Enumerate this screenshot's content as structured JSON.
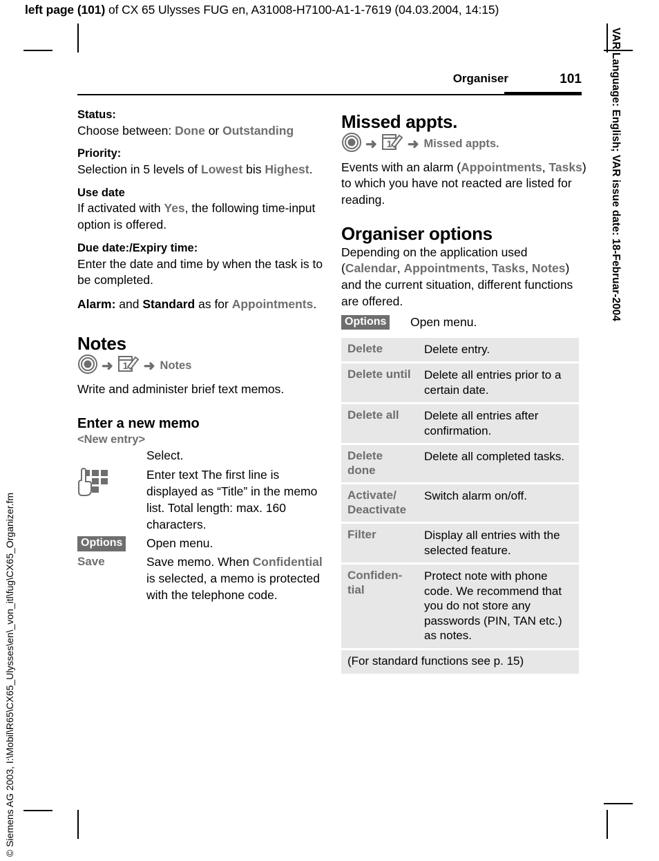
{
  "print_header": {
    "bold_prefix": "left page (101)",
    "rest": " of CX 65 Ulysses FUG en, A31008-H7100-A1-1-7619 (04.03.2004, 14:15)"
  },
  "margin_notes": {
    "right": "VAR Language: English; VAR issue date: 18-Februar-2004",
    "left": "© Siemens AG 2003, I:\\Mobil\\R65\\CX65_Ulysses\\en\\_von_itl\\fug\\CX65_Organizer.fm"
  },
  "page_header": {
    "chapter": "Organiser",
    "folio": "101"
  },
  "left_column": {
    "status": {
      "heading": "Status:",
      "text_prefix": "Choose between: ",
      "gui_1": "Done",
      "mid": " or ",
      "gui_2": "Outstanding"
    },
    "priority": {
      "heading": "Priority:",
      "text_prefix": "Selection in 5 levels of ",
      "gui_1": "Lowest",
      "mid": " bis ",
      "gui_2": "Highest",
      "suffix": "."
    },
    "use_date": {
      "heading": "Use date",
      "text_prefix": "If activated with ",
      "gui_1": "Yes",
      "suffix": ", the following time-input option is offered."
    },
    "due_date": {
      "heading": "Due date:/Expiry time:",
      "text": "Enter the date and time by when the task is to be completed."
    },
    "alarm": {
      "kw_1": "Alarm:",
      "mid_1": " and ",
      "kw_2": "Standard",
      "mid_2": " as for ",
      "gui_1": "Appointments",
      "suffix": "."
    },
    "notes_section": {
      "title": "Notes",
      "nav": {
        "arrow": "➜",
        "menu_number": "1",
        "target": "Notes"
      },
      "intro": "Write and administer brief text memos."
    },
    "new_memo": {
      "title": "Enter a new memo",
      "new_entry_label": "<New entry>",
      "rows": [
        {
          "key_type": "none",
          "key": "",
          "value": "Select."
        },
        {
          "key_type": "keypad-icon",
          "key": "keypad-icon",
          "value": "Enter text The first line is displayed as “Title” in the memo list. Total length: max. 160 characters."
        },
        {
          "key_type": "softkey",
          "key": "Options",
          "value": "Open menu."
        }
      ],
      "save_row": {
        "key": "Save",
        "prefix": "Save memo. When ",
        "gui_1": "Confidential",
        "suffix": " is selected, a memo is protected with the telephone code."
      }
    }
  },
  "right_column": {
    "missed": {
      "title": "Missed appts.",
      "nav": {
        "arrow": "➜",
        "menu_number": "1",
        "target": "Missed appts."
      },
      "text_prefix": "Events with an alarm (",
      "gui_1": "Appointments",
      "comma": ", ",
      "gui_2": "Tasks",
      "suffix": ") to which you have not reacted are listed for reading."
    },
    "organiser_options": {
      "title": "Organiser options",
      "intro_1": "Depending on the application used (",
      "gui_1": "Calendar",
      "sep_1": ", ",
      "gui_2": "Appointments",
      "sep_2": ", ",
      "gui_3": "Tasks",
      "sep_3": ", ",
      "gui_4": "Notes",
      "intro_2": ") and the current situation, different functions are offered.",
      "softkey": "Options",
      "softkey_desc": "Open menu.",
      "table": {
        "rows": [
          {
            "label": "Delete",
            "desc": "Delete entry."
          },
          {
            "label": "Delete until",
            "desc": "Delete all entries prior to a certain date."
          },
          {
            "label": "Delete all",
            "desc": "Delete all entries after confirmation."
          },
          {
            "label": "Delete done",
            "desc": "Delete all completed tasks."
          },
          {
            "label": "Activate/ Deactivate",
            "desc": "Switch alarm on/off."
          },
          {
            "label": "Filter",
            "desc": "Display all entries with the selected feature."
          },
          {
            "label": "Confiden- tial",
            "desc": "Protect note with phone code. We recommend that you do not store any passwords (PIN, TAN etc.) as notes."
          }
        ],
        "footnote": "(For standard functions see  p. 15)"
      }
    }
  },
  "colors": {
    "gui_gray": "#6e6e6e",
    "table_row_bg": "#e7e7e7",
    "softkey_bg": "#6e6e6e"
  }
}
